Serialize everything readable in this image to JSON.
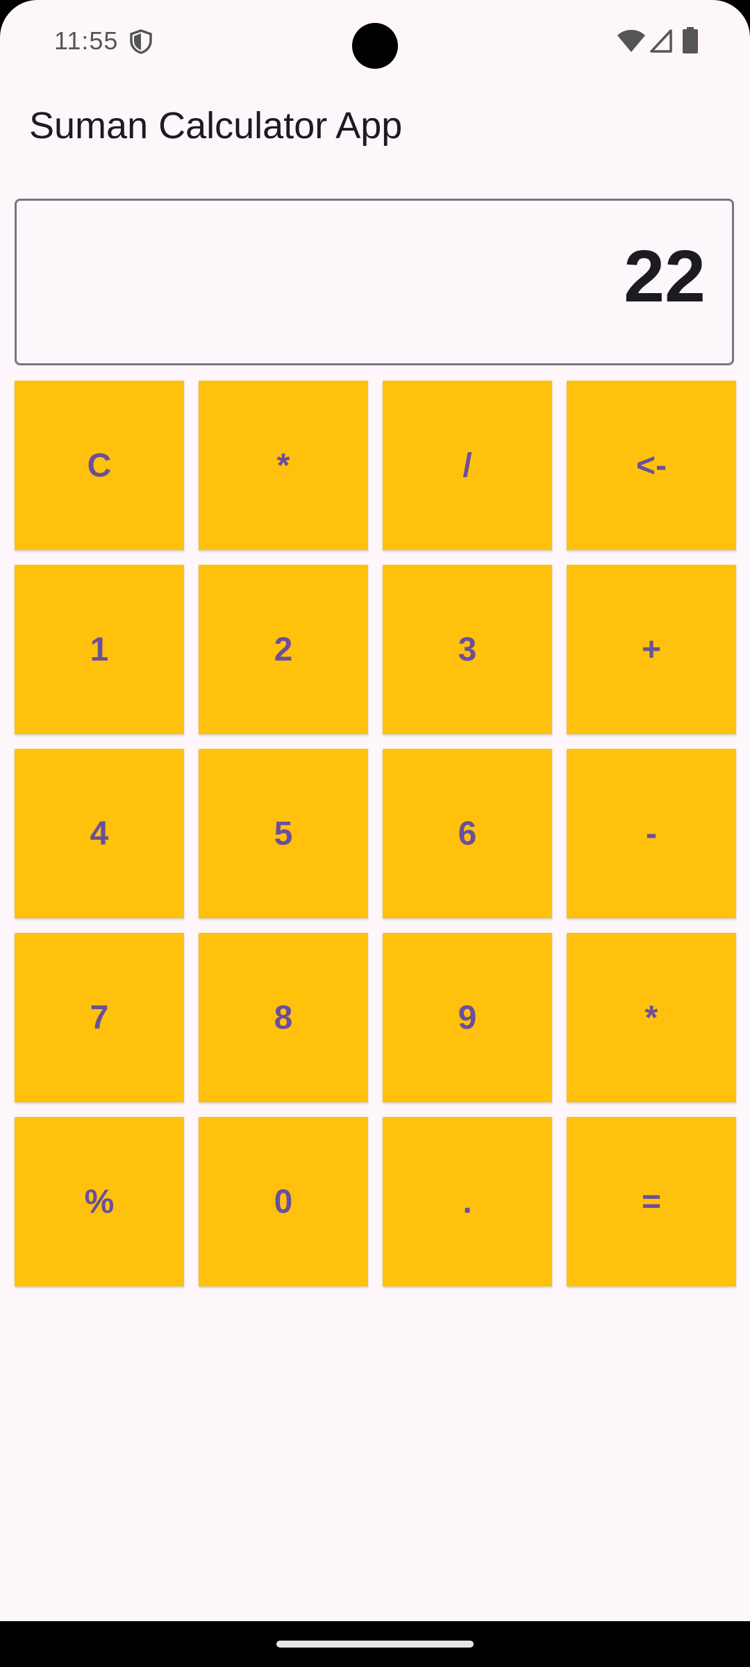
{
  "status_bar": {
    "time": "11:55",
    "icons": [
      "shield-icon",
      "wifi-icon",
      "cellular-signal-icon",
      "battery-icon"
    ]
  },
  "app": {
    "title": "Suman Calculator App"
  },
  "display": {
    "value": "22"
  },
  "keypad": {
    "keys": [
      {
        "label": "C",
        "name": "clear-button"
      },
      {
        "label": "*",
        "name": "multiply-button-top"
      },
      {
        "label": "/",
        "name": "divide-button"
      },
      {
        "label": "<-",
        "name": "backspace-button"
      },
      {
        "label": "1",
        "name": "digit-1-button"
      },
      {
        "label": "2",
        "name": "digit-2-button"
      },
      {
        "label": "3",
        "name": "digit-3-button"
      },
      {
        "label": "+",
        "name": "plus-button"
      },
      {
        "label": "4",
        "name": "digit-4-button"
      },
      {
        "label": "5",
        "name": "digit-5-button"
      },
      {
        "label": "6",
        "name": "digit-6-button"
      },
      {
        "label": "-",
        "name": "minus-button"
      },
      {
        "label": "7",
        "name": "digit-7-button"
      },
      {
        "label": "8",
        "name": "digit-8-button"
      },
      {
        "label": "9",
        "name": "digit-9-button"
      },
      {
        "label": "*",
        "name": "multiply-button"
      },
      {
        "label": "%",
        "name": "percent-button"
      },
      {
        "label": "0",
        "name": "digit-0-button"
      },
      {
        "label": ".",
        "name": "decimal-button"
      },
      {
        "label": "=",
        "name": "equals-button"
      }
    ]
  },
  "colors": {
    "background": "#FDF7FC",
    "key_background": "#FFC10C",
    "key_text": "#6A4F9B",
    "display_border": "#79747E",
    "text_primary": "#1C1B1F"
  }
}
